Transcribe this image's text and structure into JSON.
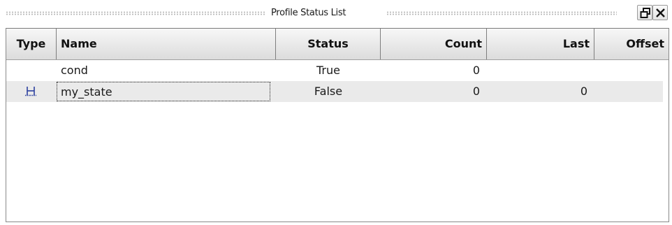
{
  "window": {
    "title": "Profile Status List"
  },
  "columns": [
    {
      "key": "type",
      "label": "Type"
    },
    {
      "key": "name",
      "label": "Name"
    },
    {
      "key": "status",
      "label": "Status"
    },
    {
      "key": "count",
      "label": "Count"
    },
    {
      "key": "last",
      "label": "Last"
    },
    {
      "key": "offset",
      "label": "Offset"
    }
  ],
  "rows": [
    {
      "type_icon": "",
      "name": "cond",
      "status": "True",
      "count": "0",
      "last": "",
      "offset": ""
    },
    {
      "type_icon": "state-icon",
      "name": "my_state",
      "status": "False",
      "count": "0",
      "last": "0",
      "offset": ""
    }
  ],
  "colors": {
    "selected_row": "#eaeaea",
    "header_bg": "#dcdcdc",
    "state_icon": "#2b3f9e"
  }
}
